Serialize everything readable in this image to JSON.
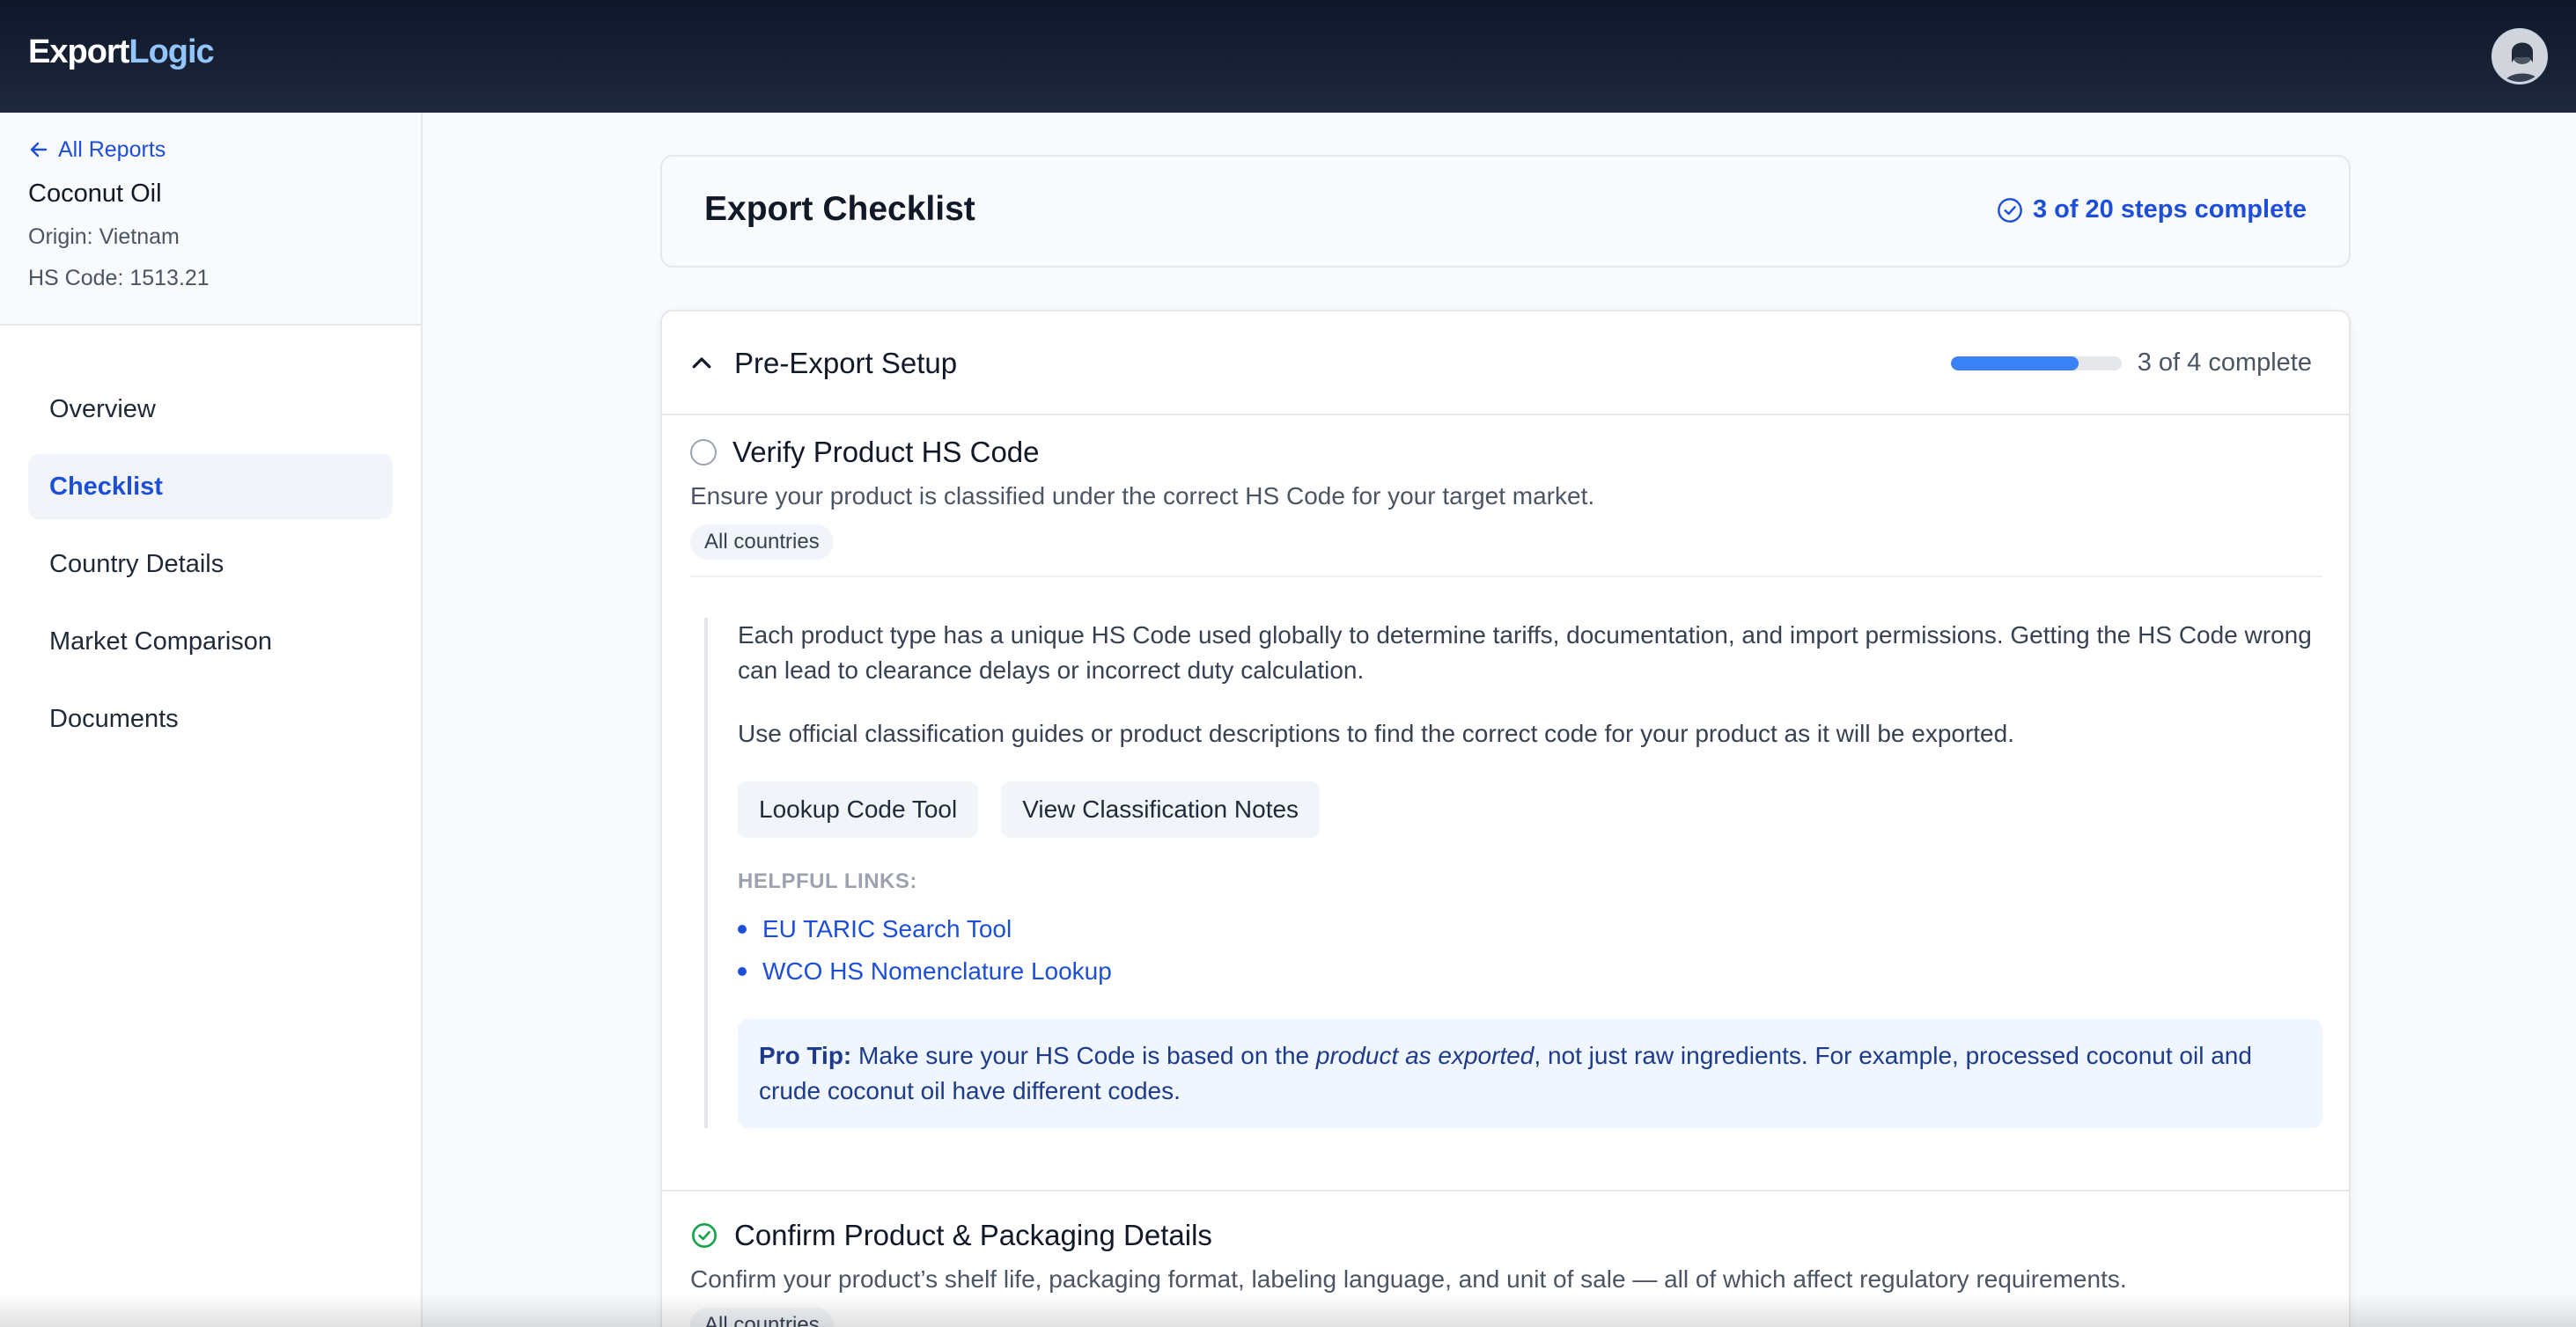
{
  "app": {
    "logo_primary": "Export",
    "logo_accent": "Logic"
  },
  "sidebar": {
    "back_label": "All Reports",
    "product_name": "Coconut Oil",
    "origin": "Origin: Vietnam",
    "hs_code": "HS Code: 1513.21",
    "nav": [
      {
        "label": "Overview"
      },
      {
        "label": "Checklist",
        "active": true
      },
      {
        "label": "Country Details"
      },
      {
        "label": "Market Comparison"
      },
      {
        "label": "Documents"
      }
    ]
  },
  "header": {
    "title": "Export Checklist",
    "progress_text": "3 of 20 steps complete"
  },
  "section": {
    "title": "Pre-Export Setup",
    "progress_text": "3 of 4 complete",
    "progress_fraction": 0.75,
    "items": [
      {
        "title": "Verify Product HS Code",
        "status": "incomplete",
        "description": "Ensure your product is classified under the correct HS Code for your target market.",
        "tag": "All countries",
        "detail_p1": "Each product type has a unique HS Code used globally to determine tariffs, documentation, and import permissions. Getting the HS Code wrong can lead to clearance delays or incorrect duty calculation.",
        "detail_p2": "Use official classification guides or product descriptions to find the correct code for your product as it will be exported.",
        "buttons": [
          "Lookup Code Tool",
          "View Classification Notes"
        ],
        "helpful_label": "HELPFUL LINKS:",
        "links": [
          "EU TARIC Search Tool",
          "WCO HS Nomenclature Lookup"
        ],
        "tip_label": "Pro Tip:",
        "tip_before": " Make sure your HS Code is based on the ",
        "tip_emphasis": "product as exported",
        "tip_after": ", not just raw ingredients. For example, processed coconut oil and crude coconut oil have different codes."
      },
      {
        "title": "Confirm Product & Packaging Details",
        "status": "complete",
        "description": "Confirm your product’s shelf life, packaging format, labeling language, and unit of sale — all of which affect regulatory requirements.",
        "tag": "All countries"
      }
    ]
  },
  "colors": {
    "accent": "#1d4ed8",
    "progress_fill": "#3b82f6",
    "complete_green": "#16a34a",
    "topbar": "#0f172a"
  }
}
